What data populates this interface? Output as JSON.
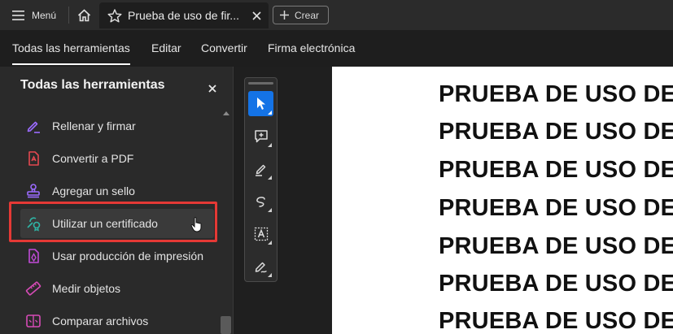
{
  "titlebar": {
    "menu_label": "Menú",
    "document_tab_title": "Prueba de uso de fir...",
    "create_label": "Crear"
  },
  "nav": {
    "tabs": [
      {
        "label": "Todas las herramientas",
        "active": true
      },
      {
        "label": "Editar",
        "active": false
      },
      {
        "label": "Convertir",
        "active": false
      },
      {
        "label": "Firma electrónica",
        "active": false
      }
    ]
  },
  "panel": {
    "title": "Todas las herramientas",
    "items": [
      {
        "label": "Rellenar y firmar",
        "icon": "fill-sign-icon",
        "color": "#9b6bff"
      },
      {
        "label": "Convertir a PDF",
        "icon": "convert-pdf-icon",
        "color": "#e34850"
      },
      {
        "label": "Agregar un sello",
        "icon": "stamp-icon",
        "color": "#9b6bff"
      },
      {
        "label": "Utilizar un certificado",
        "icon": "certificate-icon",
        "color": "#2fb5a5"
      },
      {
        "label": "Usar producción de impresión",
        "icon": "print-production-icon",
        "color": "#c14bd8"
      },
      {
        "label": "Medir objetos",
        "icon": "measure-icon",
        "color": "#d64bb6"
      },
      {
        "label": "Comparar archivos",
        "icon": "compare-icon",
        "color": "#d64bb6"
      }
    ],
    "highlighted_item": "Utilizar un certificado"
  },
  "toolbar": {
    "tools": [
      "select-cursor-icon",
      "add-comment-icon",
      "highlight-icon",
      "draw-freehand-icon",
      "text-select-icon",
      "sign-icon"
    ],
    "active_tool": "select-cursor-icon",
    "accent_color": "#1473e6"
  },
  "document": {
    "lines": [
      "PRUEBA DE USO DE FIRMA",
      "PRUEBA DE USO DE FIRMA",
      "PRUEBA DE USO DE FIRMA",
      "PRUEBA DE USO DE FIRMA",
      "PRUEBA DE USO DE FIRMA",
      "PRUEBA DE USO DE FIRMA",
      "PRUEBA DE USO DE FIRMA"
    ]
  }
}
